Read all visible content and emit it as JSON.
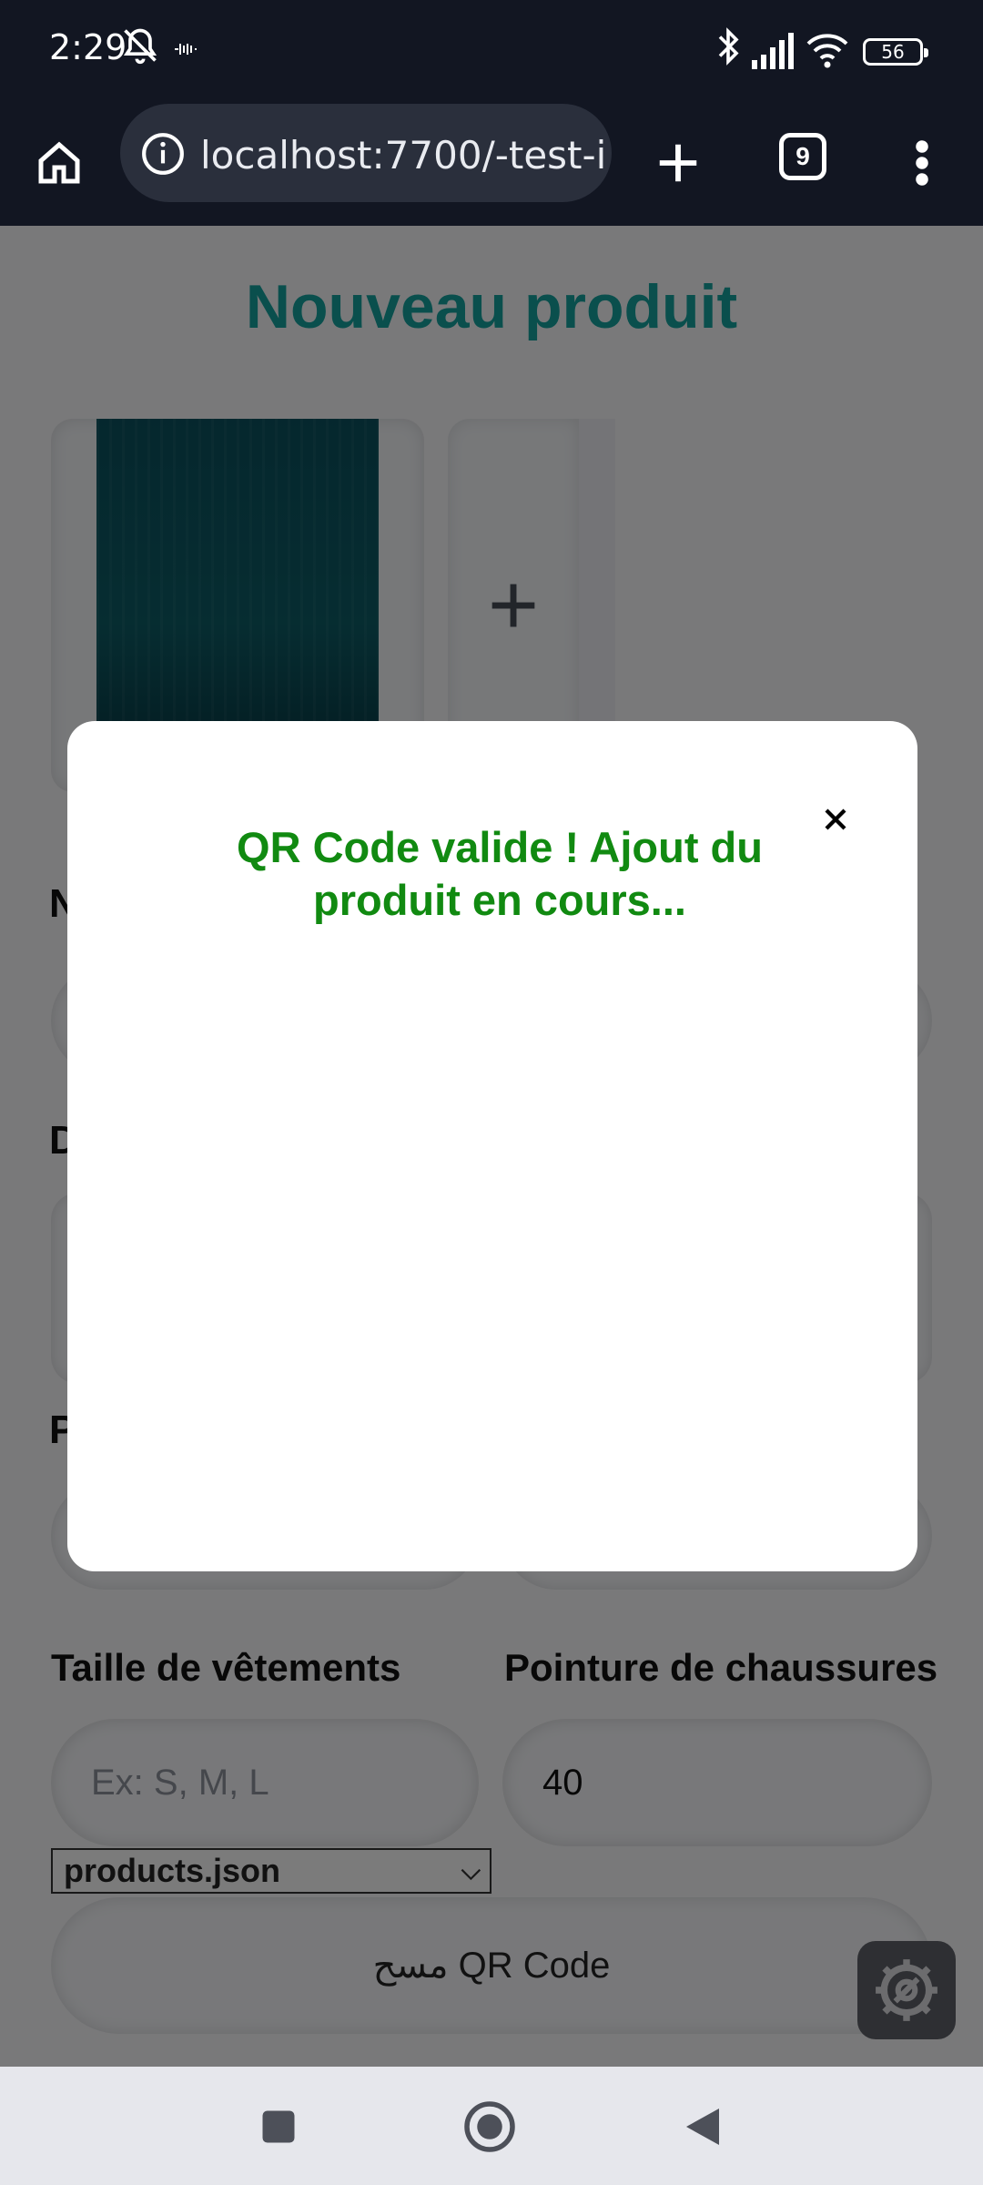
{
  "status": {
    "time": "2:29",
    "battery": "56"
  },
  "browser": {
    "url": "localhost:7700/-test-i",
    "tab_count": "9"
  },
  "page": {
    "title": "Nouveau produit",
    "add_image_symbol": "+",
    "clothing_size_label": "Taille de vêtements",
    "clothing_size_placeholder": "Ex: S, M, L",
    "shoe_size_label": "Pointure de chaussures",
    "shoe_size_value": "40",
    "source_select_value": "products.json",
    "scan_button_label": "مسح QR Code",
    "hidden_label_n": "N",
    "hidden_label_d": "D",
    "hidden_label_p": "P"
  },
  "modal": {
    "message": "QR Code valide ! Ajout du produit en cours..."
  },
  "colors": {
    "title": "#149e9b",
    "success_text": "#118a11",
    "status_bar": "#121622"
  }
}
